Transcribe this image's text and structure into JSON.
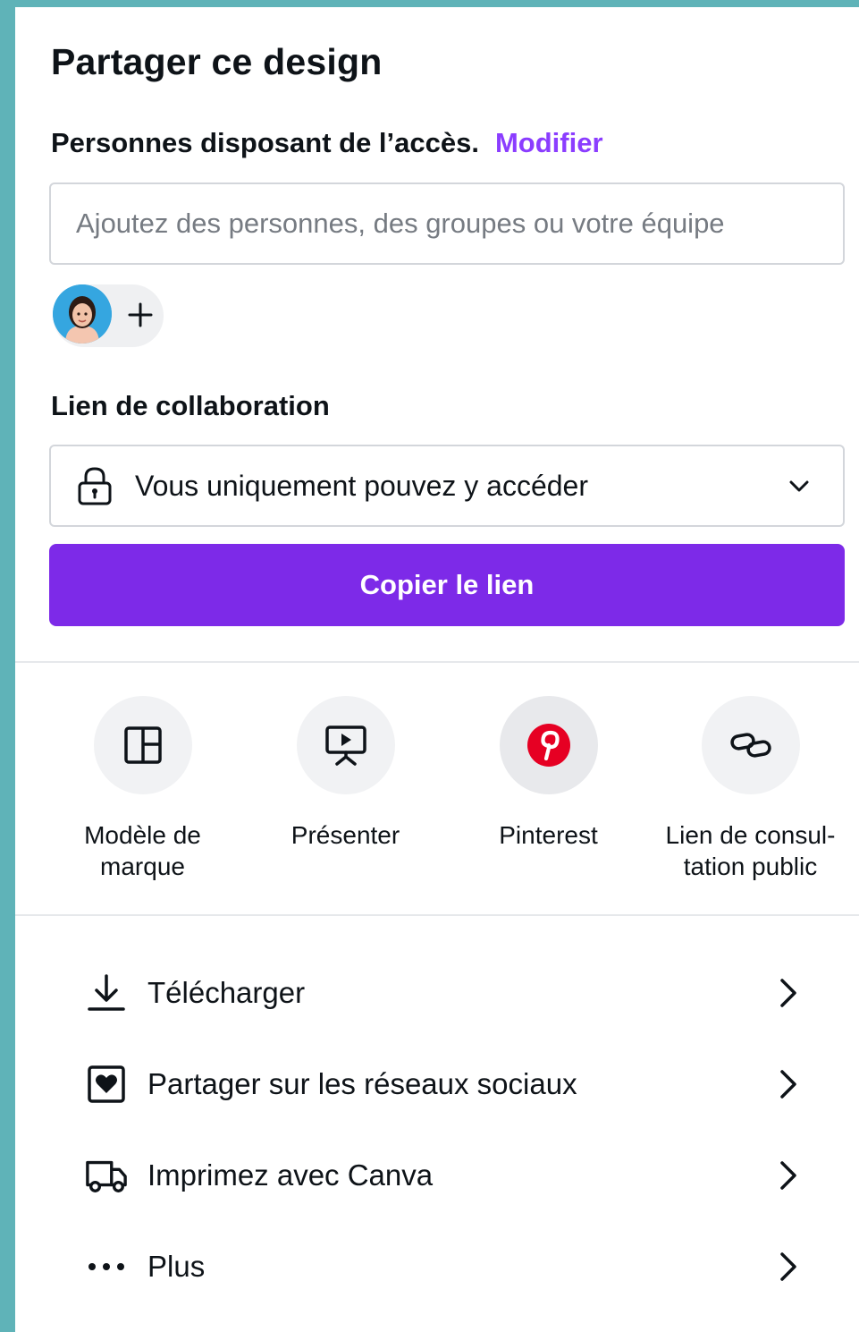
{
  "share": {
    "title": "Partager ce design",
    "access_label": "Personnes disposant de l’accès.",
    "modify_link": "Modifier",
    "add_placeholder": "Ajoutez des personnes, des groupes ou votre équipe",
    "collab_title": "Lien de collaboration",
    "access_option": "Vous uniquement pouvez y accéder",
    "copy_button": "Copier le lien"
  },
  "quick_actions": [
    {
      "label": "Modèle de marque",
      "icon": "brand-template-icon"
    },
    {
      "label": "Présenter",
      "icon": "present-icon"
    },
    {
      "label": "Pinterest",
      "icon": "pinterest-icon"
    },
    {
      "label": "Lien de consul-tation public",
      "icon": "link-icon"
    }
  ],
  "menu": [
    {
      "label": "Télécharger",
      "icon": "download-icon"
    },
    {
      "label": "Partager sur les réseaux sociaux",
      "icon": "social-share-icon"
    },
    {
      "label": "Imprimez avec Canva",
      "icon": "print-truck-icon"
    },
    {
      "label": "Plus",
      "icon": "more-icon"
    }
  ],
  "colors": {
    "accent": "#7d2ae8",
    "link": "#8b3dff",
    "pinterest": "#e60023",
    "background": "#5fb3b8"
  }
}
